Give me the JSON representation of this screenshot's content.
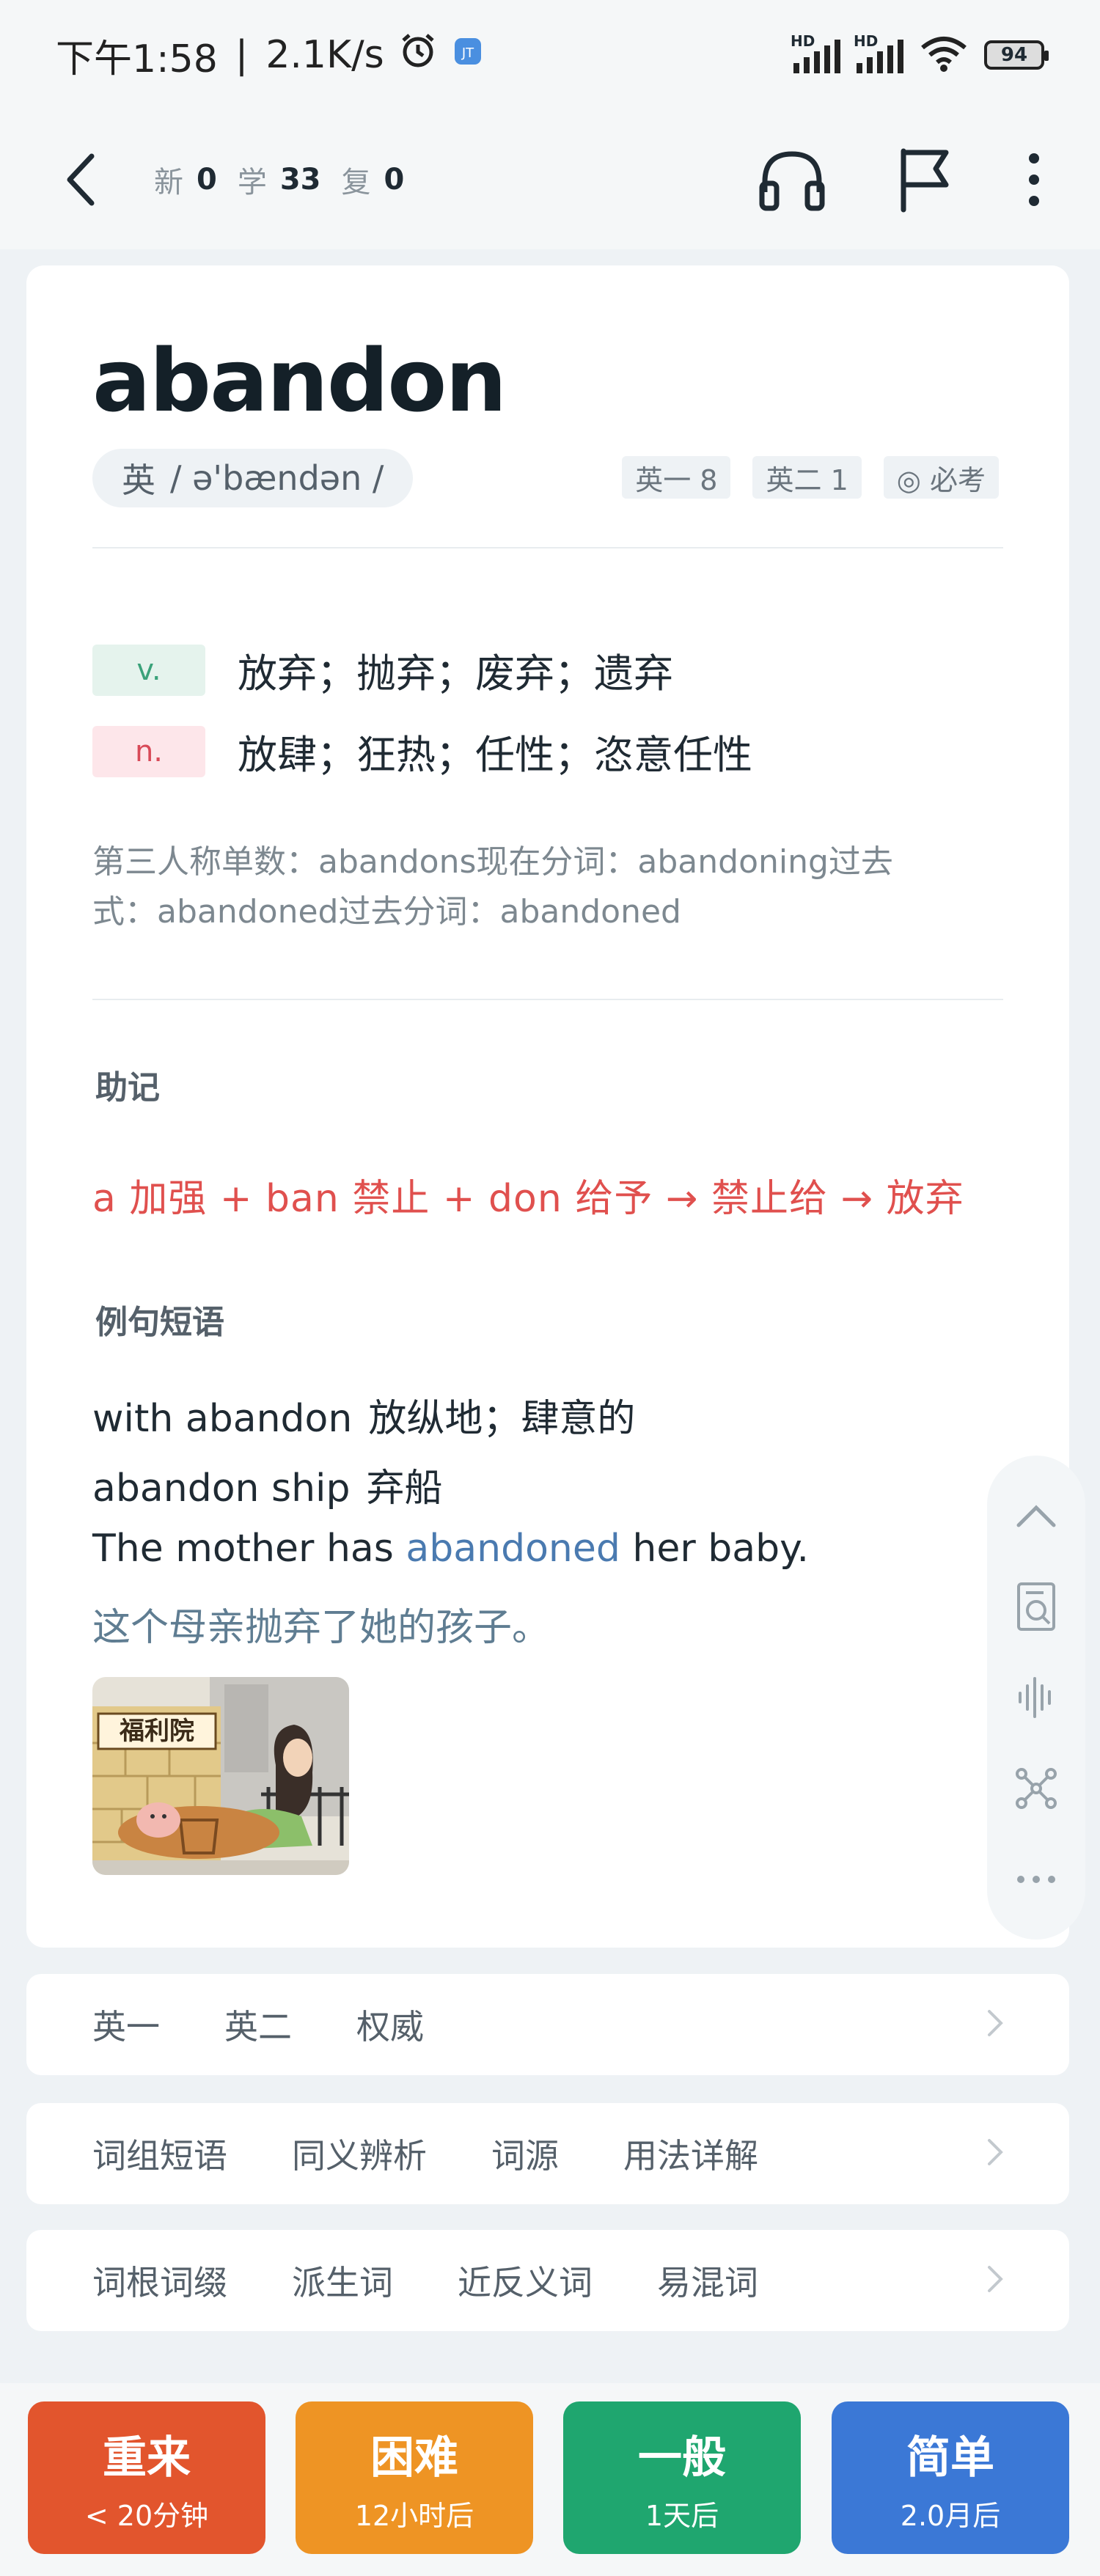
{
  "status": {
    "time": "下午1:58",
    "speed": "2.1K/s",
    "battery": "94"
  },
  "nav": {
    "labels": {
      "new": "新",
      "learn": "学",
      "review": "复"
    },
    "values": {
      "new": "0",
      "learn": "33",
      "review": "0"
    }
  },
  "word": {
    "title": "abandon",
    "phonetic_region": "英",
    "phonetic": "/ ə'bændən /",
    "tags": [
      "英一 8",
      "英二 1",
      "◎ 必考"
    ],
    "definitions": [
      {
        "pos": "v.",
        "text": "放弃；抛弃；废弃；遗弃"
      },
      {
        "pos": "n.",
        "text": "放肆；狂热；任性；恣意任性"
      }
    ],
    "forms_line1": "第三人称单数：abandons现在分词：abandoning过去",
    "forms_line2": "式：abandoned过去分词：abandoned"
  },
  "mnemonic": {
    "label": "助记",
    "text": "a 加强 + ban 禁止 + don 给予 → 禁止给 → 放弃"
  },
  "examples": {
    "label": "例句短语",
    "phrases": [
      {
        "en": "with abandon",
        "zh": "放纵地；肆意的"
      },
      {
        "en": "abandon ship",
        "zh": "弃船"
      }
    ],
    "sentence_before": "The mother has ",
    "sentence_highlight": "abandoned",
    "sentence_after": " her baby.",
    "sentence_zh": "这个母亲抛弃了她的孩子。",
    "image_sign": "福利院"
  },
  "links": {
    "row1": [
      "英一",
      "英二",
      "权威"
    ],
    "row2": [
      "词组短语",
      "同义辨析",
      "词源",
      "用法详解"
    ],
    "row3": [
      "词根词缀",
      "派生词",
      "近反义词",
      "易混词"
    ]
  },
  "rating": [
    {
      "label": "重来",
      "sub": "< 20分钟",
      "color": "#e2552d"
    },
    {
      "label": "困难",
      "sub": "12小时后",
      "color": "#ee9424"
    },
    {
      "label": "一般",
      "sub": "1天后",
      "color": "#1fa66f"
    },
    {
      "label": "简单",
      "sub": "2.0月后",
      "color": "#3b78d6"
    }
  ]
}
